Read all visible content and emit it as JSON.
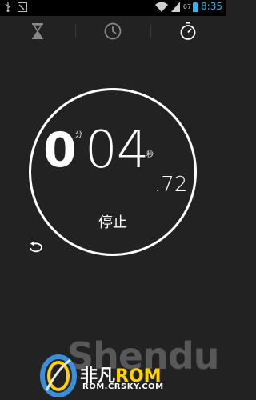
{
  "status_bar": {
    "time": "8:35",
    "battery_percent": "67",
    "icons": [
      "usb-icon",
      "screenshot-icon",
      "wifi-icon",
      "signal-icon",
      "battery-icon"
    ],
    "time_color": "#33b5e5"
  },
  "tabs": [
    {
      "icon": "hourglass-icon",
      "selected": false
    },
    {
      "icon": "clock-icon",
      "selected": false
    },
    {
      "icon": "stopwatch-icon",
      "selected": true
    }
  ],
  "stopwatch": {
    "minutes": "0",
    "minutes_unit": "分",
    "seconds": "04",
    "seconds_unit": "秒",
    "hundredths": ".72",
    "stop_label": "停止",
    "reset_icon": "reset-icon"
  },
  "watermark": {
    "brand_prefix": "非凡",
    "brand_rom": "ROM",
    "domain": "ROM.CRSKY.COM",
    "shadow_text": "Shendu"
  }
}
